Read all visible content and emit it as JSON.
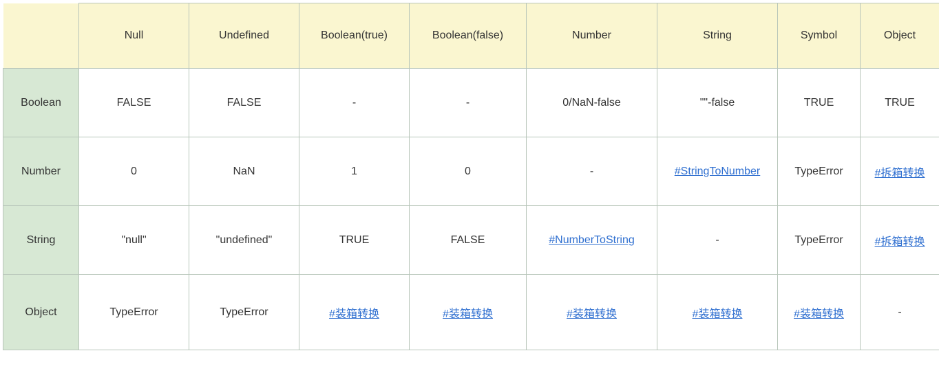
{
  "columns": [
    "Null",
    "Undefined",
    "Boolean(true)",
    "Boolean(false)",
    "Number",
    "String",
    "Symbol",
    "Object"
  ],
  "rows": [
    {
      "label": "Boolean",
      "cells": [
        {
          "text": "FALSE"
        },
        {
          "text": "FALSE"
        },
        {
          "text": "-"
        },
        {
          "text": "-"
        },
        {
          "text": "0/NaN-false"
        },
        {
          "text": "\"\"-false"
        },
        {
          "text": "TRUE"
        },
        {
          "text": "TRUE"
        }
      ]
    },
    {
      "label": "Number",
      "cells": [
        {
          "text": "0"
        },
        {
          "text": "NaN"
        },
        {
          "text": "1"
        },
        {
          "text": "0"
        },
        {
          "text": "-"
        },
        {
          "text": "#StringToNumber",
          "link": true
        },
        {
          "text": "TypeError"
        },
        {
          "text": "#拆箱转换",
          "link": true
        }
      ]
    },
    {
      "label": "String",
      "cells": [
        {
          "text": "\"null\""
        },
        {
          "text": "\"undefined\""
        },
        {
          "text": "TRUE"
        },
        {
          "text": "FALSE"
        },
        {
          "text": "#NumberToString",
          "link": true
        },
        {
          "text": "-"
        },
        {
          "text": "TypeError"
        },
        {
          "text": "#拆箱转换",
          "link": true
        }
      ]
    },
    {
      "label": "Object",
      "cells": [
        {
          "text": "TypeError"
        },
        {
          "text": "TypeError"
        },
        {
          "text": "#装箱转换",
          "link": true
        },
        {
          "text": "#装箱转换",
          "link": true
        },
        {
          "text": "#装箱转换",
          "link": true
        },
        {
          "text": "#装箱转换",
          "link": true
        },
        {
          "text": "#装箱转换",
          "link": true
        },
        {
          "text": "-"
        }
      ]
    }
  ]
}
